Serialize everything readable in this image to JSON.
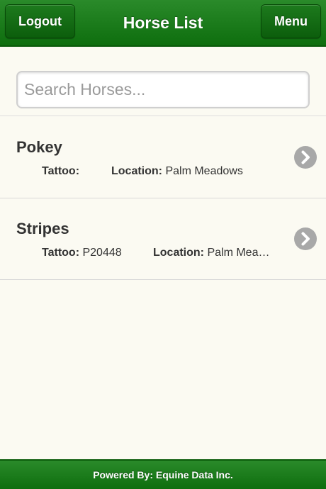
{
  "header": {
    "title": "Horse List",
    "logout_label": "Logout",
    "menu_label": "Menu"
  },
  "search": {
    "placeholder": "Search Horses...",
    "value": ""
  },
  "horses": [
    {
      "name": "Pokey",
      "tattoo_label": "Tattoo:",
      "tattoo": "",
      "location_label": "Location:",
      "location": "Palm Meadows"
    },
    {
      "name": "Stripes",
      "tattoo_label": "Tattoo:",
      "tattoo": "P20448",
      "location_label": "Location:",
      "location": "Palm Mea…"
    }
  ],
  "footer": {
    "text": "Powered By: Equine Data Inc."
  },
  "colors": {
    "header_green": "#1a7d1a",
    "background": "#fbfaf2",
    "chevron_gray": "#a8a8a8"
  },
  "icons": {
    "row_action": "chevron-right-circle-icon"
  }
}
